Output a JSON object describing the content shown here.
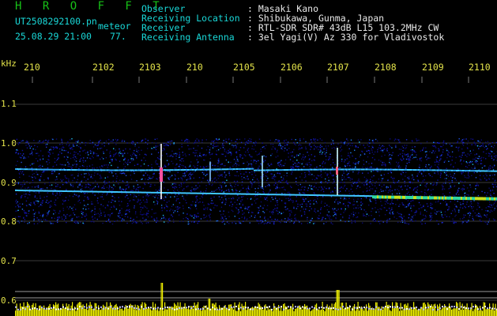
{
  "header": {
    "brand": "H R O F F T",
    "filename": "UT2508292100.pn",
    "mode": "meteor",
    "datetime": "25.08.29 21:00",
    "count": "77.",
    "fields": [
      {
        "label": "Observer",
        "value": ": Masaki Kano"
      },
      {
        "label": "Receiving Location",
        "value": ": Shibukawa, Gunma, Japan"
      },
      {
        "label": "Receiver",
        "value": ": RTL-SDR SDR# 43dB L15 103.2MHz CW"
      },
      {
        "label": "Receiving Antenna",
        "value": ": 3el Yagi(V) Az 330 for Vladivostok"
      }
    ]
  },
  "y_axis": {
    "unit": "kHz",
    "ticks": [
      "1.1",
      "1.0",
      "0.9",
      "0.8",
      "0.7",
      "0.6"
    ]
  },
  "time_axis": {
    "ticks": [
      "210",
      "2102",
      "2103",
      "210",
      "2105",
      "2106",
      "2107",
      "2108",
      "2109",
      "2110"
    ]
  },
  "colors": {
    "background": "#000000",
    "brand": "#17c117",
    "label": "#19d7d7",
    "value": "#e8e8e8",
    "axis_text": "#e3e34a",
    "grid": "#7a7a7a",
    "level_bars": "#f0f000"
  }
}
